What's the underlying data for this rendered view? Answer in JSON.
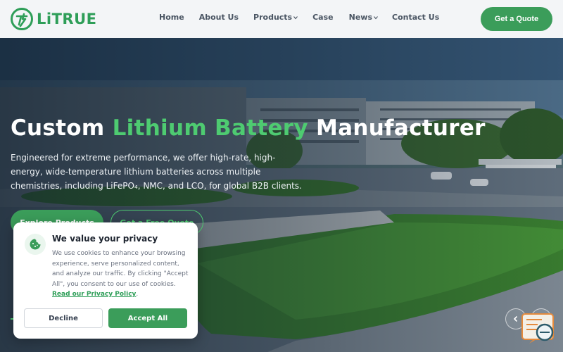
{
  "brand": {
    "name": "LiTRUE",
    "color": "#2e9e58"
  },
  "nav": {
    "items": [
      {
        "label": "Home",
        "has_dropdown": false
      },
      {
        "label": "About Us",
        "has_dropdown": false
      },
      {
        "label": "Products",
        "has_dropdown": true
      },
      {
        "label": "Case",
        "has_dropdown": false
      },
      {
        "label": "News",
        "has_dropdown": true
      },
      {
        "label": "Contact Us",
        "has_dropdown": false
      }
    ],
    "cta_label": "Get a Quote"
  },
  "hero": {
    "title_part1": "Custom ",
    "title_accent": "Lithium Battery",
    "title_part2": " Manufacturer",
    "description": "Engineered for extreme performance, we offer high-rate, high-energy, wide-temperature lithium batteries across multiple chemistries, including LiFePO₄, NMC, and LCO, for global B2B clients.",
    "primary_button": "Explore Products",
    "secondary_button": "Get a Free Quote",
    "accent_color": "#4ecb71"
  },
  "cookie": {
    "title": "We value your privacy",
    "text": "We use cookies to enhance your browsing experience, serve personalized content, and analyze our traffic. By clicking \"Accept All\", you consent to our use of cookies.",
    "link_label": "Read our Privacy Policy",
    "text_end": ".",
    "decline_label": "Decline",
    "accept_label": "Accept All"
  },
  "icons": {
    "logo": "litrue-logo-icon",
    "cookie": "cookie-icon",
    "prev": "chevron-left-icon",
    "next": "chevron-right-icon",
    "chat": "chat-support-icon"
  }
}
